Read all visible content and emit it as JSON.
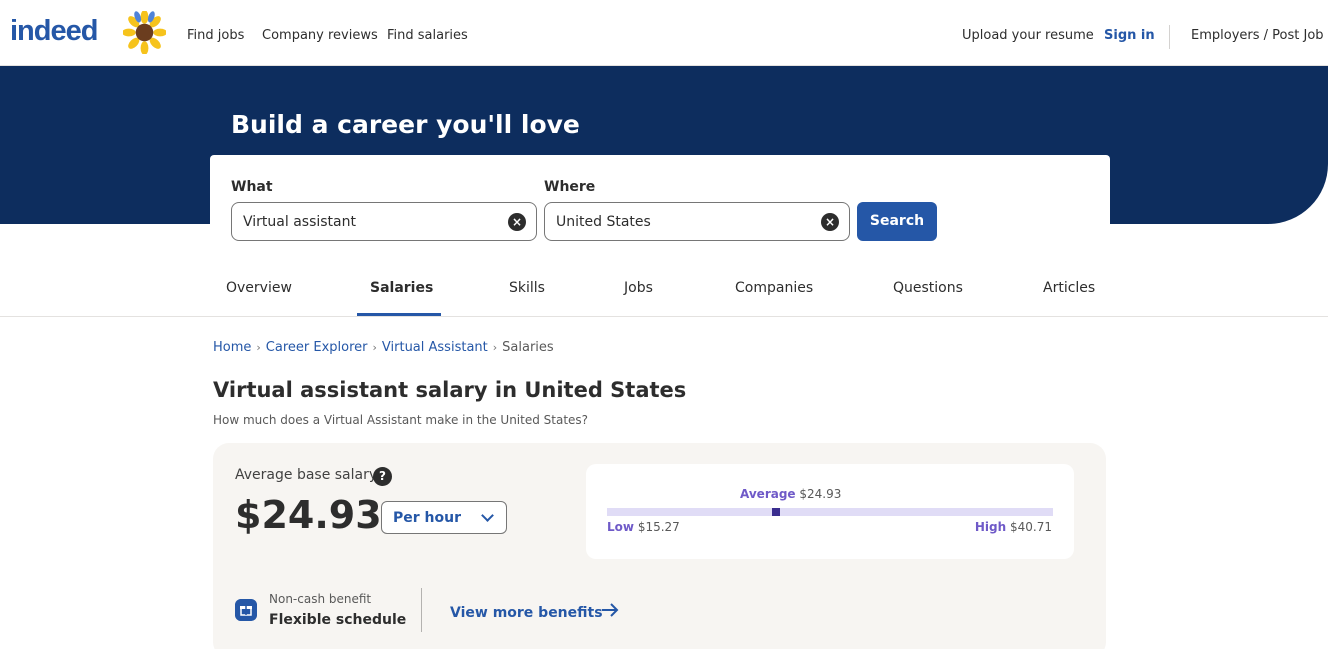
{
  "header": {
    "logo_text": "indeed",
    "nav": [
      "Find jobs",
      "Company reviews",
      "Find salaries"
    ],
    "upload_resume": "Upload your resume",
    "sign_in": "Sign in",
    "employers": "Employers / Post Job"
  },
  "hero": {
    "title": "Build a career you'll love"
  },
  "search": {
    "what_label": "What",
    "what_value": "Virtual assistant",
    "where_label": "Where",
    "where_value": "United States",
    "button": "Search"
  },
  "tabs": [
    {
      "label": "Overview",
      "active": false
    },
    {
      "label": "Salaries",
      "active": true
    },
    {
      "label": "Skills",
      "active": false
    },
    {
      "label": "Jobs",
      "active": false
    },
    {
      "label": "Companies",
      "active": false
    },
    {
      "label": "Questions",
      "active": false
    },
    {
      "label": "Articles",
      "active": false
    }
  ],
  "breadcrumb": {
    "items": [
      "Home",
      "Career Explorer",
      "Virtual Assistant"
    ],
    "current": "Salaries"
  },
  "page": {
    "title": "Virtual assistant salary in United States",
    "subtitle": "How much does a Virtual Assistant make in the United States?"
  },
  "salary": {
    "avg_label": "Average base salary",
    "help_icon": "?",
    "value": "$24.93",
    "period": "Per hour",
    "range": {
      "avg_key": "Average",
      "avg_value": "$24.93",
      "low_key": "Low",
      "low_value": "$15.27",
      "high_key": "High",
      "high_value": "$40.71",
      "low_num": 15.27,
      "avg_num": 24.93,
      "high_num": 40.71
    },
    "benefit": {
      "icon": "gift-icon",
      "kind": "Non-cash benefit",
      "name": "Flexible schedule"
    },
    "more_benefits": "View more benefits"
  },
  "colors": {
    "brand_blue": "#2557a7",
    "hero_navy": "#0d2d5e",
    "range_purple": "#6f5ac8"
  }
}
